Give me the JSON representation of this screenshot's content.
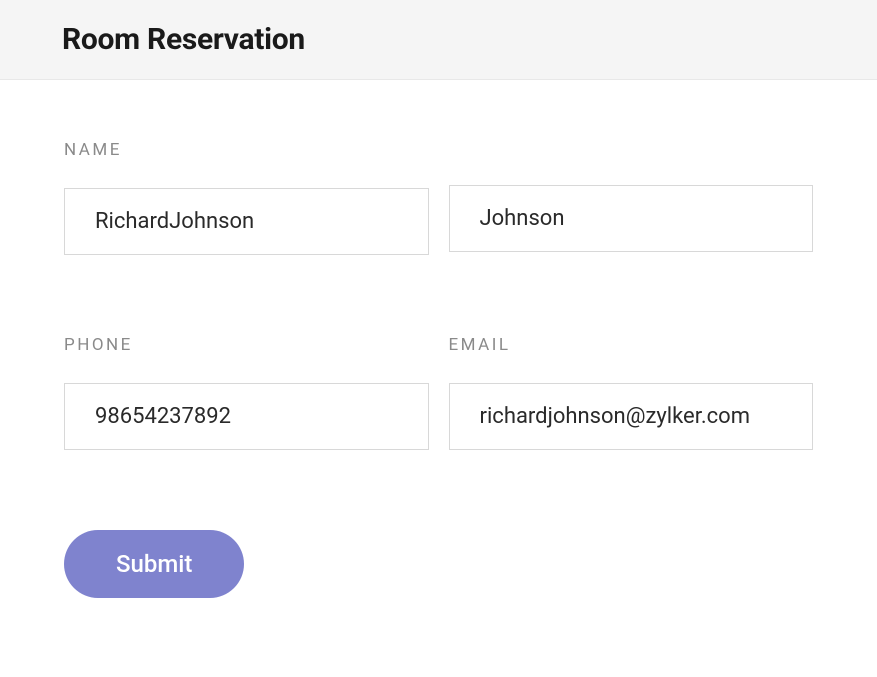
{
  "header": {
    "title": "Room Reservation"
  },
  "form": {
    "labels": {
      "name": "NAME",
      "phone": "PHONE",
      "email": "EMAIL"
    },
    "fields": {
      "first_name": "RichardJohnson",
      "last_name": "Johnson",
      "phone": "98654237892",
      "email": "richardjohnson@zylker.com"
    },
    "submit_label": "Submit"
  }
}
